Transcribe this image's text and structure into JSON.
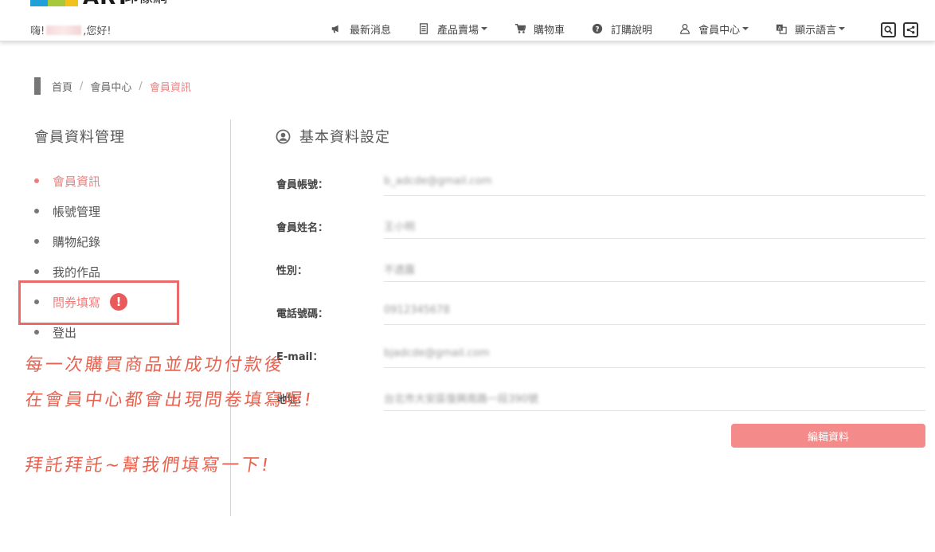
{
  "header": {
    "logo": {
      "brand": "ART",
      "brand_sub": "印像網"
    },
    "greeting": {
      "prefix": "嗨!",
      "suffix": ",您好!"
    },
    "nav": [
      {
        "label": "最新消息",
        "icon": "bullhorn-icon",
        "dropdown": false
      },
      {
        "label": "產品賣場",
        "icon": "document-icon",
        "dropdown": true
      },
      {
        "label": "購物車",
        "icon": "cart-icon",
        "dropdown": false
      },
      {
        "label": "訂購說明",
        "icon": "question-circle-icon",
        "dropdown": false
      },
      {
        "label": "會員中心",
        "icon": "user-icon",
        "dropdown": true
      },
      {
        "label": "顯示語言",
        "icon": "translate-icon",
        "dropdown": true
      }
    ]
  },
  "breadcrumb": {
    "home": "首頁",
    "section": "會員中心",
    "current": "會員資訊",
    "separator": "/"
  },
  "sidebar": {
    "title": "會員資料管理",
    "items": [
      {
        "label": "會員資訊",
        "active": true
      },
      {
        "label": "帳號管理"
      },
      {
        "label": "購物紀錄"
      },
      {
        "label": "我的作品"
      },
      {
        "label": "問券填寫",
        "alert": "!"
      },
      {
        "label": "登出"
      }
    ]
  },
  "main": {
    "title": "基本資料設定",
    "fields": [
      {
        "label": "會員帳號：",
        "value": "b_adcde@gmail.com"
      },
      {
        "label": "會員姓名：",
        "value": "王小明"
      },
      {
        "label": "性別：",
        "value": "不透露"
      },
      {
        "label": "電話號碼：",
        "value": "0912345678"
      },
      {
        "label": "E-mail：",
        "value": "bjadcde@gmail.com"
      },
      {
        "label": "地址：",
        "value": "台北市大安區復興南路一段390號"
      }
    ],
    "edit_button": "編輯資料"
  },
  "annotation": {
    "line1": "每一次購買商品並成功付款後",
    "line2": "在會員中心都會出現問卷填寫喔!",
    "line3": "拜託拜託~幫我們填寫一下!"
  },
  "colors": {
    "accent": "#f07d7d",
    "button": "#f58a8a",
    "alert": "#e95b5b",
    "highlight": "#e96a6a"
  }
}
